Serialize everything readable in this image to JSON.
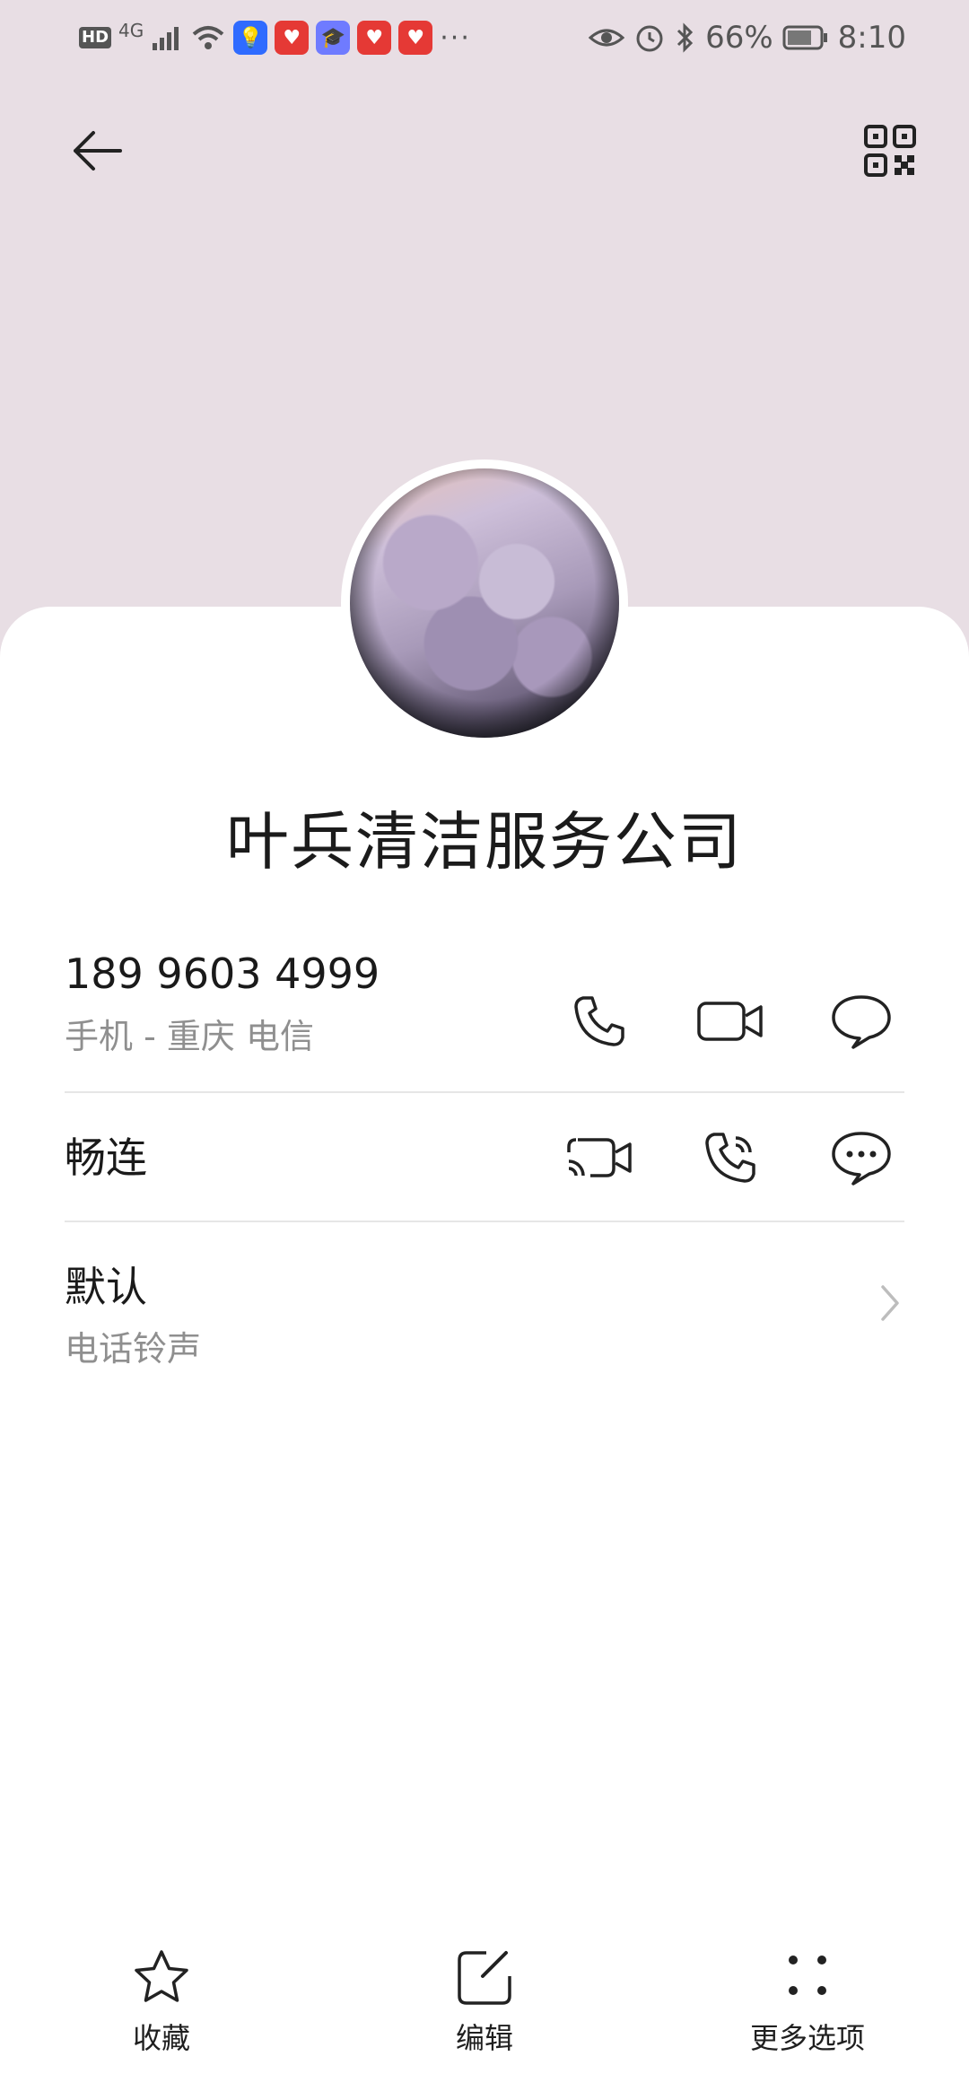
{
  "status_bar": {
    "hd": "HD",
    "network": "4G",
    "battery": "66%",
    "time": "8:10",
    "more": "···"
  },
  "header": {
    "back_icon": "back-arrow-icon",
    "qr_icon": "qr-code-icon"
  },
  "contact": {
    "name": "叶兵清洁服务公司"
  },
  "phone": {
    "number": "189 9603 4999",
    "detail": "手机 - 重庆 电信",
    "actions": [
      "phone-icon",
      "video-call-icon",
      "message-icon"
    ]
  },
  "channel": {
    "label": "畅连",
    "actions": [
      "cast-video-icon",
      "voice-call-icon",
      "chat-icon"
    ]
  },
  "ringtone": {
    "value": "默认",
    "label": "电话铃声"
  },
  "bottom_nav": {
    "favorite": "收藏",
    "edit": "编辑",
    "more": "更多选项"
  },
  "colors": {
    "header_bg": "#e8dee4",
    "card_bg": "#ffffff",
    "text_primary": "#1a1a1a",
    "text_secondary": "#8f8f8f"
  }
}
